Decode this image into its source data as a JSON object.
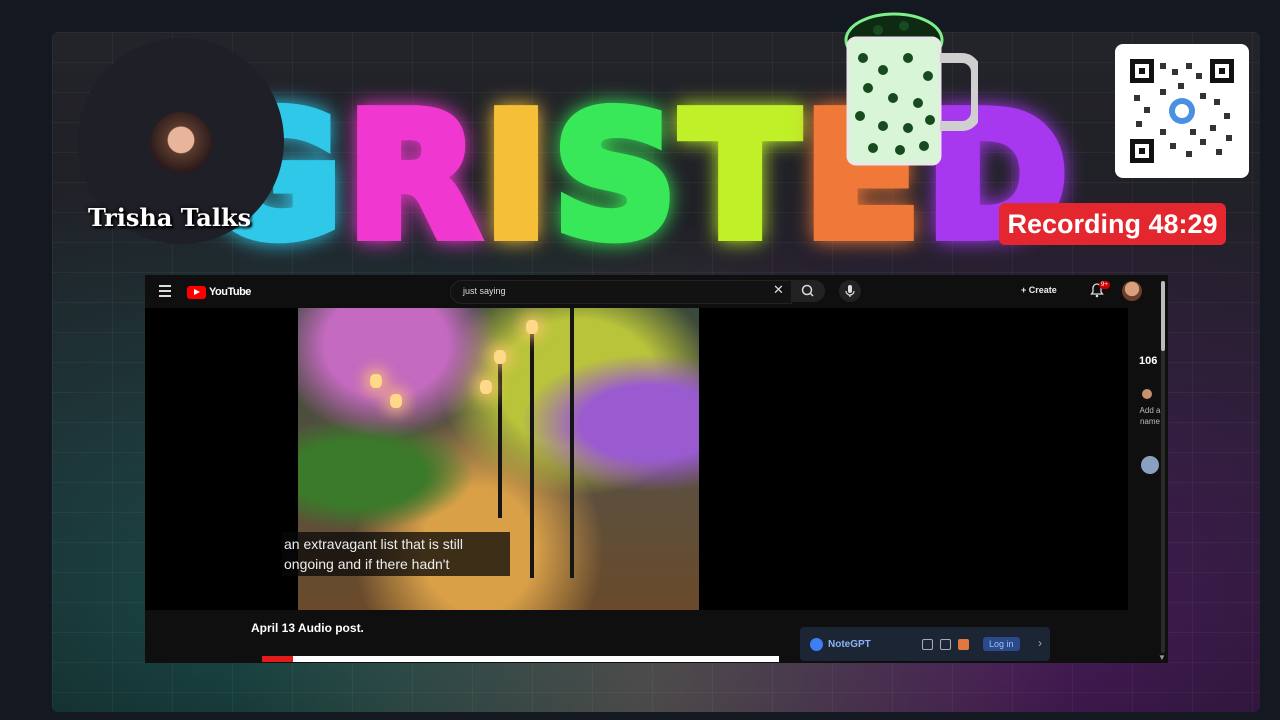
{
  "stream": {
    "neon_text": "GRISTED",
    "camera_name": "Trisha Talks",
    "recording_label": "Recording 48:29"
  },
  "youtube": {
    "logo_text": "YouTube",
    "search_value": "just saying",
    "create_label": "Create",
    "notification_badge": "9+",
    "caption_lines": [
      "an extravagant list that is still",
      "ongoing and if there hadn't"
    ],
    "video_title": "April 13 Audio post.",
    "progress": 0.06,
    "side_count": "106",
    "side_add_label": "Add a name"
  },
  "extension": {
    "name": "NoteGPT",
    "login_label": "Log in"
  },
  "colors": {
    "recording_red": "#e4262f",
    "youtube_red": "#ff0000",
    "neon": [
      "#30c8e8",
      "#f038d0",
      "#f5c038",
      "#38e858",
      "#c0f028",
      "#f07838",
      "#a838f0"
    ]
  }
}
